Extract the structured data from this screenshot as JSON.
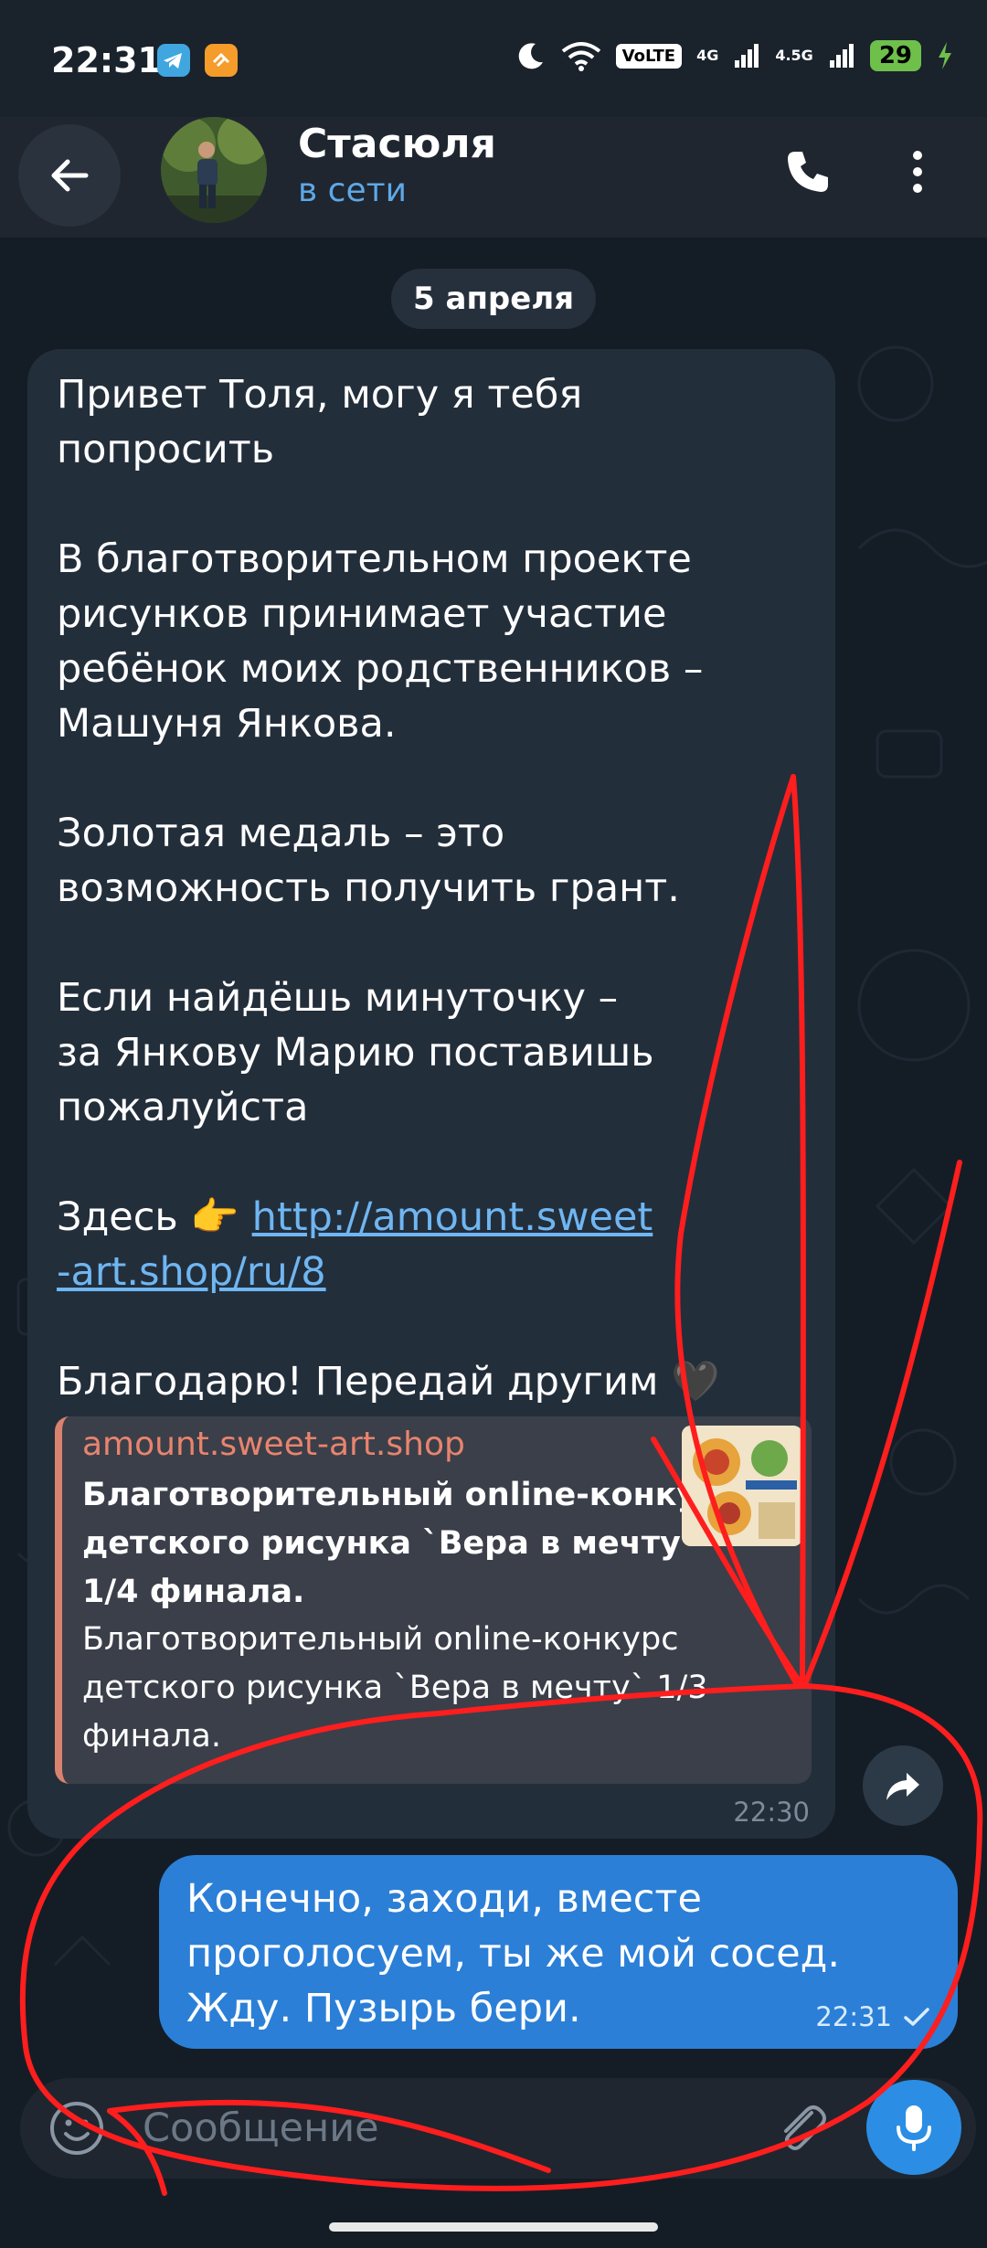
{
  "status_bar": {
    "time": "22:31",
    "network_volte": "VoLTE",
    "network_1": "4G",
    "network_2": "4.5G",
    "battery": "29",
    "colors": {
      "telegram_icon": "#3fa6e0",
      "second_app_icon": "#f59c2a",
      "battery": "#6fbf4b"
    }
  },
  "header": {
    "contact_name": "Стасюля",
    "status": "в сети",
    "icons": [
      "back-arrow-icon",
      "phone-icon",
      "more-vert-icon"
    ]
  },
  "chat": {
    "date_label": "5 апреля",
    "incoming": {
      "paragraph_1": "Привет Толя, могу я тебя\nпопросить",
      "paragraph_2": "В благотворительном проекте\nрисунков принимает участие\nребёнок моих родственников –\nМашуня Янкова.",
      "paragraph_3": "Золотая медаль – это\nвозможность получить грант.",
      "paragraph_4": "Если найдёшь минуточку –\nза Янкову Марию поставишь\nпожалуйста",
      "here_label": "Здесь 👉 ",
      "link": "http://amount.sweet\n-art.shop/ru/8",
      "paragraph_6": "Благодарю! Передай другим 🖤",
      "preview": {
        "site": "amount.sweet-art.shop",
        "title": "Благотворительный online-конкурс детского рисунка `Вера в мечту` 1/4 финала.",
        "description": "Благотворительный online-конкурс детского рисунка `Вера в мечту` 1/3 финала."
      },
      "time": "22:30"
    },
    "outgoing": {
      "text": "Конечно, заходи, вместе\nпроголосуем, ты же мой сосед.\nЖду. Пузырь бери.",
      "time": "22:31",
      "status_icon": "check-icon"
    }
  },
  "composer": {
    "placeholder": "Сообщение",
    "icons": [
      "emoji-icon",
      "paperclip-icon",
      "microphone-icon"
    ]
  },
  "annotation": {
    "color": "#ff1e1e",
    "description_icon": "red-freehand-annotation"
  },
  "colors": {
    "background": "#141d26",
    "incoming_bubble": "#232e3b",
    "outgoing_bubble": "#2b7fd7",
    "accent": "#5ea8e6",
    "link_site": "#e8846e"
  }
}
